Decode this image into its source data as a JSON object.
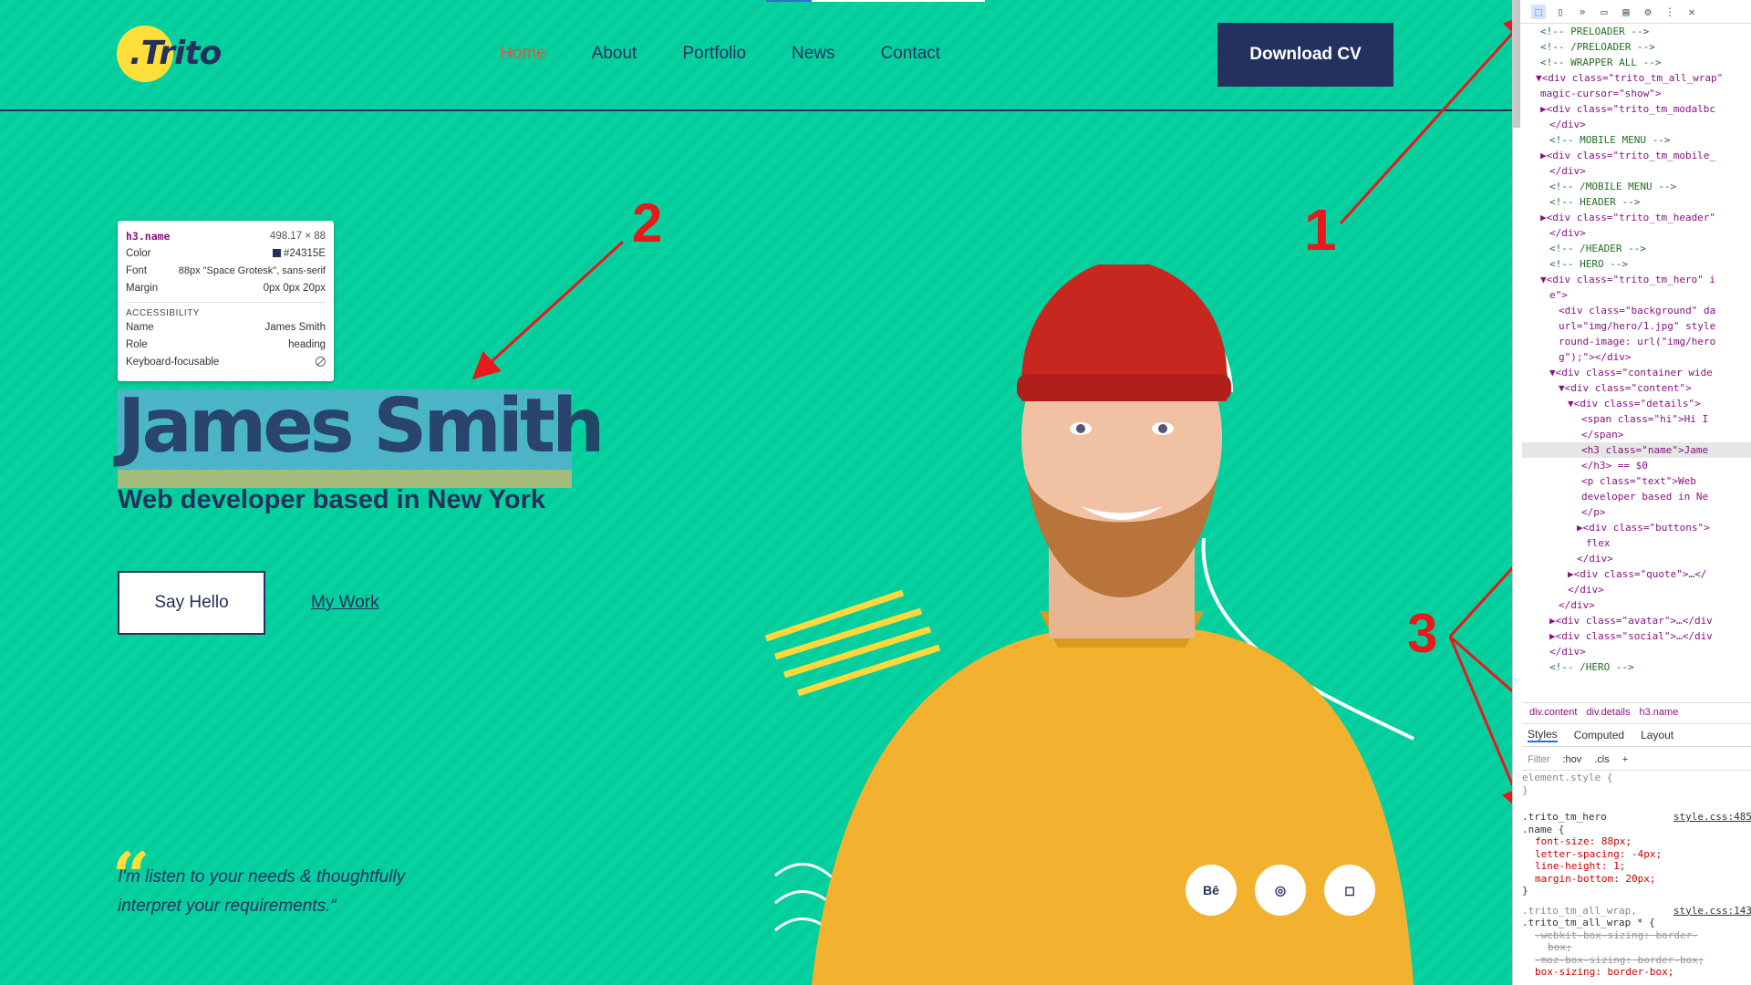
{
  "site": {
    "logo": ".Trito",
    "nav": [
      {
        "label": "Home",
        "active": true
      },
      {
        "label": "About",
        "active": false
      },
      {
        "label": "Portfolio",
        "active": false
      },
      {
        "label": "News",
        "active": false
      },
      {
        "label": "Contact",
        "active": false
      }
    ],
    "download_cv": "Download CV",
    "hero_name": "James Smith",
    "hero_subtitle": "Web developer based in New York",
    "say_hello": "Say Hello",
    "my_work": "My Work",
    "quote_line1": "I'm listen to your needs & thoughtfully",
    "quote_line2": "interpret your requirements.“",
    "social": [
      "Bē",
      "◎",
      "◻"
    ]
  },
  "tooltip": {
    "selector": "h3.name",
    "size": "498.17 × 88",
    "color_label": "Color",
    "color_value": "#24315E",
    "font_label": "Font",
    "font_value": "88px \"Space Grotesk\", sans-serif",
    "margin_label": "Margin",
    "margin_value": "0px 0px 20px",
    "accessibility": "ACCESSIBILITY",
    "name_label": "Name",
    "name_value": "James Smith",
    "role_label": "Role",
    "role_value": "heading",
    "kb_label": "Keyboard-focusable"
  },
  "annotations": [
    "1",
    "2",
    "3"
  ],
  "devtools": {
    "elements": [
      {
        "t": "cmt",
        "text": "<!-- PRELOADER -->",
        "i": 4
      },
      {
        "t": "cmt",
        "text": "<!-- /PRELOADER -->",
        "i": 4
      },
      {
        "t": "cmt",
        "text": "<!-- WRAPPER ALL -->",
        "i": 4
      },
      {
        "t": "tag",
        "text": "▼<div class=\"trito_tm_all_wrap\"",
        "i": 3
      },
      {
        "t": "tag",
        "text": "magic-cursor=\"show\">",
        "i": 4
      },
      {
        "t": "tag",
        "text": "▶<div class=\"trito_tm_modalbc",
        "i": 4
      },
      {
        "t": "tag",
        "text": "</div>",
        "i": 6
      },
      {
        "t": "cmt",
        "text": "<!-- MOBILE MENU -->",
        "i": 6
      },
      {
        "t": "tag",
        "text": "▶<div class=\"trito_tm_mobile_",
        "i": 4
      },
      {
        "t": "tag",
        "text": "</div>",
        "i": 6
      },
      {
        "t": "cmt",
        "text": "<!-- /MOBILE MENU -->",
        "i": 6
      },
      {
        "t": "cmt",
        "text": "<!-- HEADER -->",
        "i": 6
      },
      {
        "t": "tag",
        "text": "▶<div class=\"trito_tm_header\"",
        "i": 4
      },
      {
        "t": "tag",
        "text": "</div>",
        "i": 6
      },
      {
        "t": "cmt",
        "text": "<!-- /HEADER -->",
        "i": 6
      },
      {
        "t": "cmt",
        "text": "<!-- HERO -->",
        "i": 6
      },
      {
        "t": "tag",
        "text": "▼<div class=\"trito_tm_hero\" i",
        "i": 4
      },
      {
        "t": "tag",
        "text": "e\">",
        "i": 6
      },
      {
        "t": "tag",
        "text": "<div class=\"background\" da",
        "i": 8
      },
      {
        "t": "tag",
        "text": "url=\"img/hero/1.jpg\" style",
        "i": 8
      },
      {
        "t": "tag",
        "text": "round-image: url(\"img/hero",
        "i": 8
      },
      {
        "t": "tag",
        "text": "g\");\"></div>",
        "i": 8
      },
      {
        "t": "tag",
        "text": "▼<div class=\"container wide",
        "i": 6
      },
      {
        "t": "tag",
        "text": "▼<div class=\"content\">",
        "i": 8
      },
      {
        "t": "tag",
        "text": "▼<div class=\"details\">",
        "i": 10
      },
      {
        "t": "tag",
        "text": "<span class=\"hi\">Hi I",
        "i": 13
      },
      {
        "t": "tag",
        "text": "</span>",
        "i": 13
      },
      {
        "t": "sel",
        "text": "<h3 class=\"name\">Jame",
        "i": 13
      },
      {
        "t": "tag",
        "text": "</h3> == $0",
        "i": 13
      },
      {
        "t": "tag",
        "text": "<p class=\"text\">Web",
        "i": 13
      },
      {
        "t": "tag",
        "text": "developer based in Ne",
        "i": 13
      },
      {
        "t": "tag",
        "text": "</p>",
        "i": 13
      },
      {
        "t": "tag",
        "text": "▶<div class=\"buttons\">",
        "i": 12
      },
      {
        "t": "tag",
        "text": "flex",
        "i": 14
      },
      {
        "t": "tag",
        "text": "</div>",
        "i": 12
      },
      {
        "t": "tag",
        "text": "▶<div class=\"quote\">…</",
        "i": 10
      },
      {
        "t": "tag",
        "text": "</div>",
        "i": 10
      },
      {
        "t": "tag",
        "text": "</div>",
        "i": 8
      },
      {
        "t": "tag",
        "text": "▶<div class=\"avatar\">…</div",
        "i": 6
      },
      {
        "t": "tag",
        "text": "▶<div class=\"social\">…</div",
        "i": 6
      },
      {
        "t": "tag",
        "text": "</div>",
        "i": 6
      },
      {
        "t": "cmt",
        "text": "<!-- /HERO -->",
        "i": 6
      }
    ],
    "breadcrumb": [
      "div.content",
      "div.details",
      "h3.name"
    ],
    "tabs": [
      "Styles",
      "Computed",
      "Layout"
    ],
    "filter": "Filter",
    "hov": ":hov",
    "cls": ".cls",
    "element_style": "element.style {",
    "rule1_selector": ".trito_tm_hero",
    "rule1_selector2": ".name {",
    "rule1_source": "style.css:485",
    "rule1_props": [
      "font-size: 88px;",
      "letter-spacing: -4px;",
      "line-height: 1;",
      "margin-bottom: 20px;"
    ],
    "rule2_selector": ".trito_tm_all_wrap,",
    "rule2_selector2": ".trito_tm_all_wrap * {",
    "rule2_source": "style.css:143",
    "rule2_props_strike": [
      "-webkit-box-sizing: border-",
      "box;",
      "-moz-box-sizing: border-box;"
    ],
    "rule2_prop": "box-sizing: border-box;"
  }
}
